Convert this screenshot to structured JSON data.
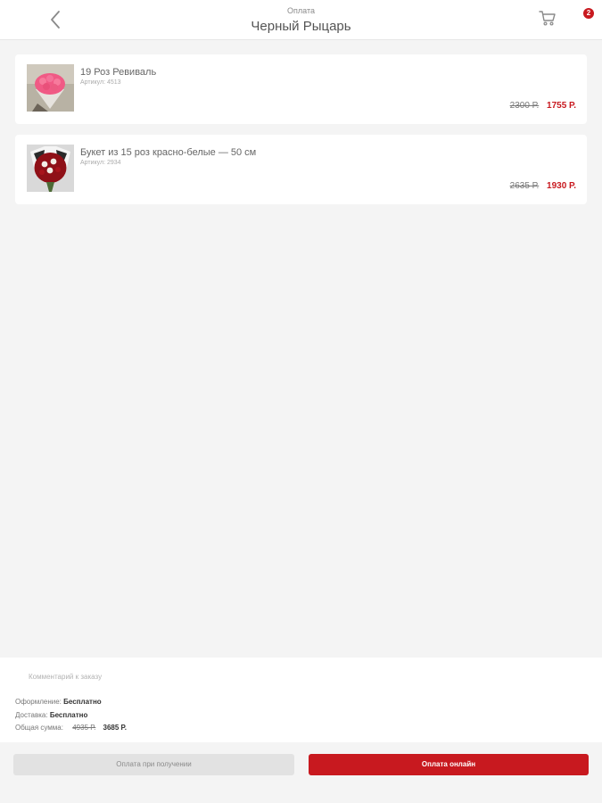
{
  "header": {
    "subtitle": "Оплата",
    "title": "Черный Рыцарь",
    "cart_count": "2"
  },
  "items": [
    {
      "name": "19 Роз Ревиваль",
      "sku": "Артикул: 4513",
      "old_price": "2300 Р.",
      "new_price": "1755 Р.",
      "thumb_icon": "pink-roses-bouquet-photo"
    },
    {
      "name": "Букет из 15 роз красно-белые — 50 см",
      "sku": "Артикул: 2934",
      "old_price": "2635 Р.",
      "new_price": "1930 Р.",
      "thumb_icon": "red-white-roses-bouquet-photo"
    }
  ],
  "order": {
    "comment_placeholder": "Комментарий к заказу",
    "processing_label": "Оформление:",
    "processing_value": "Бесплатно",
    "delivery_label": "Доставка:",
    "delivery_value": "Бесплатно",
    "total_label": "Общая сумма:",
    "total_old": "4935 Р.",
    "total_new": "3685 Р."
  },
  "buttons": {
    "cash_label": "Оплата при получении",
    "online_label": "Оплата онлайн"
  },
  "colors": {
    "accent": "#c8191f",
    "background": "#f4f4f4"
  }
}
